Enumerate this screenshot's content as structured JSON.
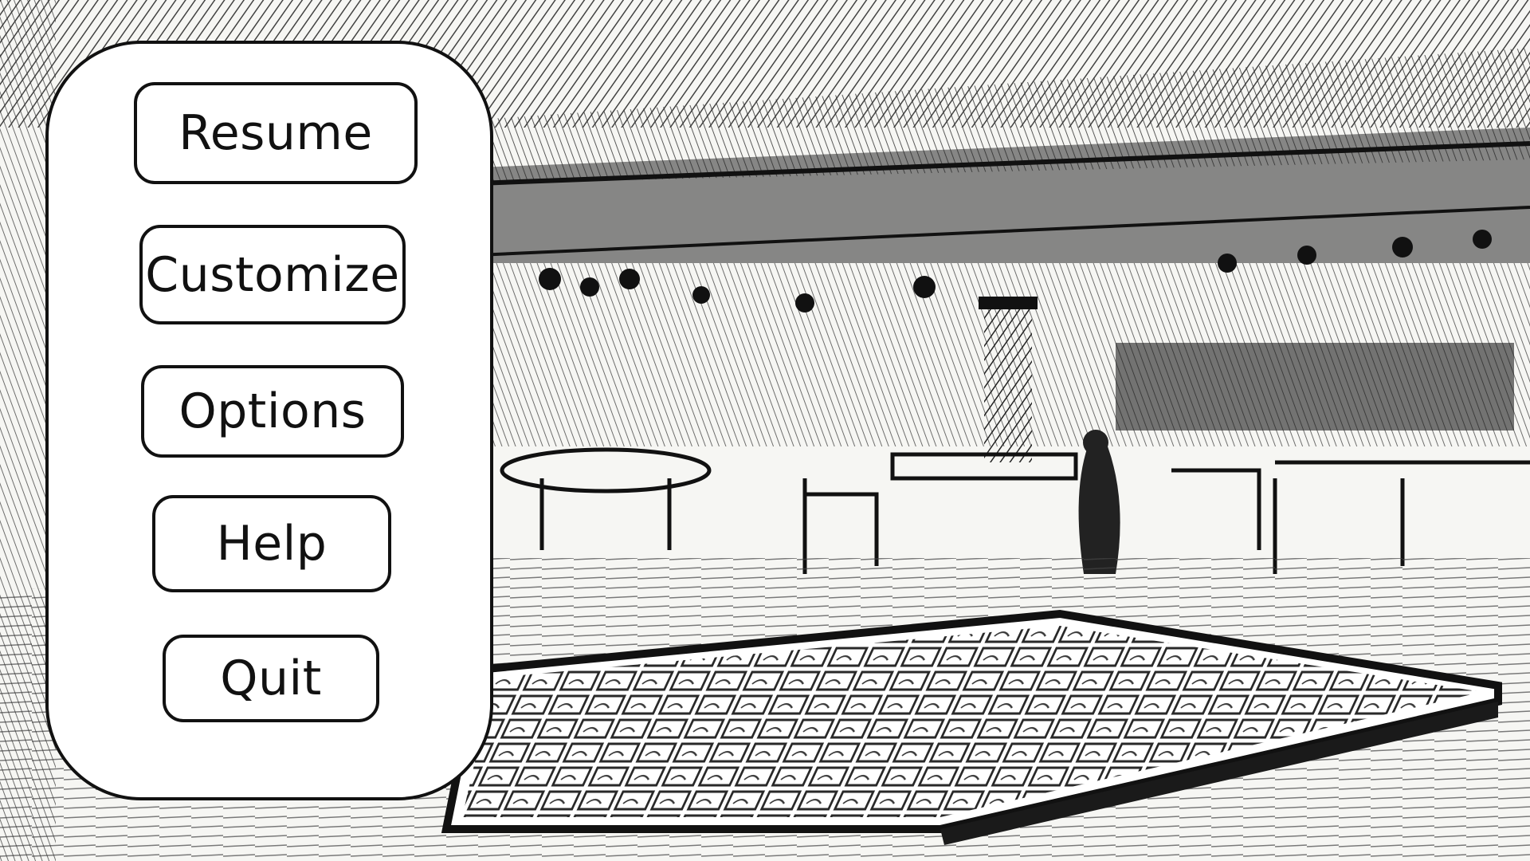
{
  "scene": {
    "background": "casino-interior-ink-sketch",
    "ink_color": "#1a1a1a",
    "paper_color": "#f4f4f2"
  },
  "pause_menu": {
    "buttons": [
      {
        "id": "resume",
        "label": "Resume"
      },
      {
        "id": "customize",
        "label": "Customize"
      },
      {
        "id": "options",
        "label": "Options"
      },
      {
        "id": "help",
        "label": "Help"
      },
      {
        "id": "quit",
        "label": "Quit"
      }
    ]
  }
}
